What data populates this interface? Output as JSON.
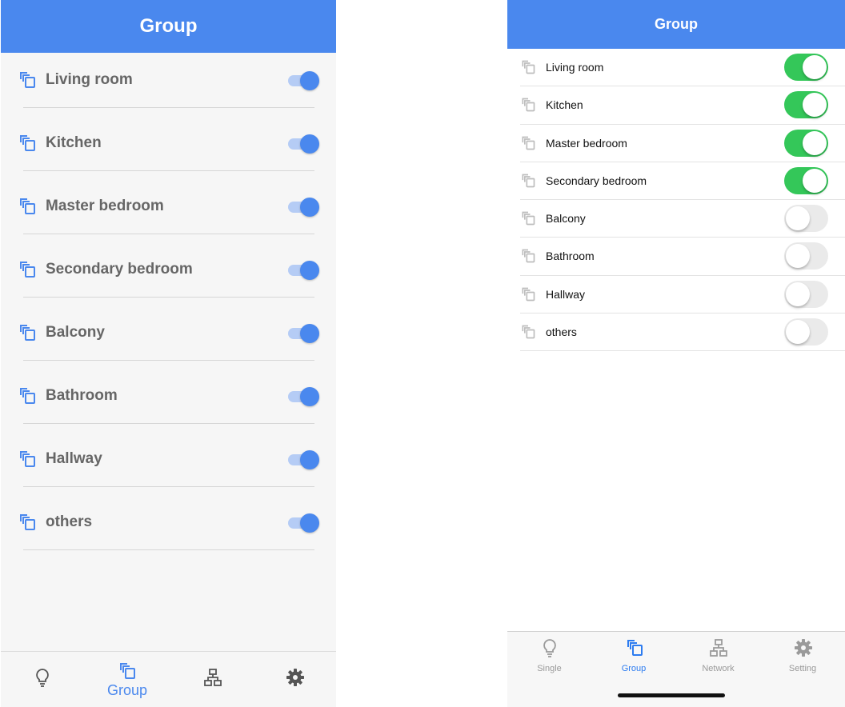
{
  "left_screen": {
    "title": "Group",
    "rows": [
      {
        "label": "Living room",
        "on": true
      },
      {
        "label": "Kitchen",
        "on": true
      },
      {
        "label": "Master bedroom",
        "on": true
      },
      {
        "label": "Secondary bedroom",
        "on": true
      },
      {
        "label": "Balcony",
        "on": true
      },
      {
        "label": "Bathroom",
        "on": true
      },
      {
        "label": "Hallway",
        "on": true
      },
      {
        "label": "others",
        "on": true
      }
    ],
    "nav": [
      {
        "icon": "bulb-icon",
        "label": "",
        "active": false
      },
      {
        "icon": "group-icon",
        "label": "Group",
        "active": true
      },
      {
        "icon": "network-icon",
        "label": "",
        "active": false
      },
      {
        "icon": "gear-icon",
        "label": "",
        "active": false
      }
    ]
  },
  "right_screen": {
    "title": "Group",
    "rows": [
      {
        "label": "Living room",
        "on": true
      },
      {
        "label": "Kitchen",
        "on": true
      },
      {
        "label": "Master bedroom",
        "on": true
      },
      {
        "label": "Secondary bedroom",
        "on": true
      },
      {
        "label": "Balcony",
        "on": false
      },
      {
        "label": "Bathroom",
        "on": false
      },
      {
        "label": "Hallway",
        "on": false
      },
      {
        "label": "others",
        "on": false
      }
    ],
    "tabs": [
      {
        "icon": "bulb-icon",
        "label": "Single",
        "active": false
      },
      {
        "icon": "group-icon",
        "label": "Group",
        "active": true
      },
      {
        "icon": "network-icon",
        "label": "Network",
        "active": false
      },
      {
        "icon": "gear-icon",
        "label": "Setting",
        "active": false
      }
    ]
  },
  "colors": {
    "header_blue": "#4a88ee",
    "switch_on_green": "#34c759",
    "active_tab_blue": "#2d7cf0",
    "inactive_gray": "#9a9a9a"
  }
}
